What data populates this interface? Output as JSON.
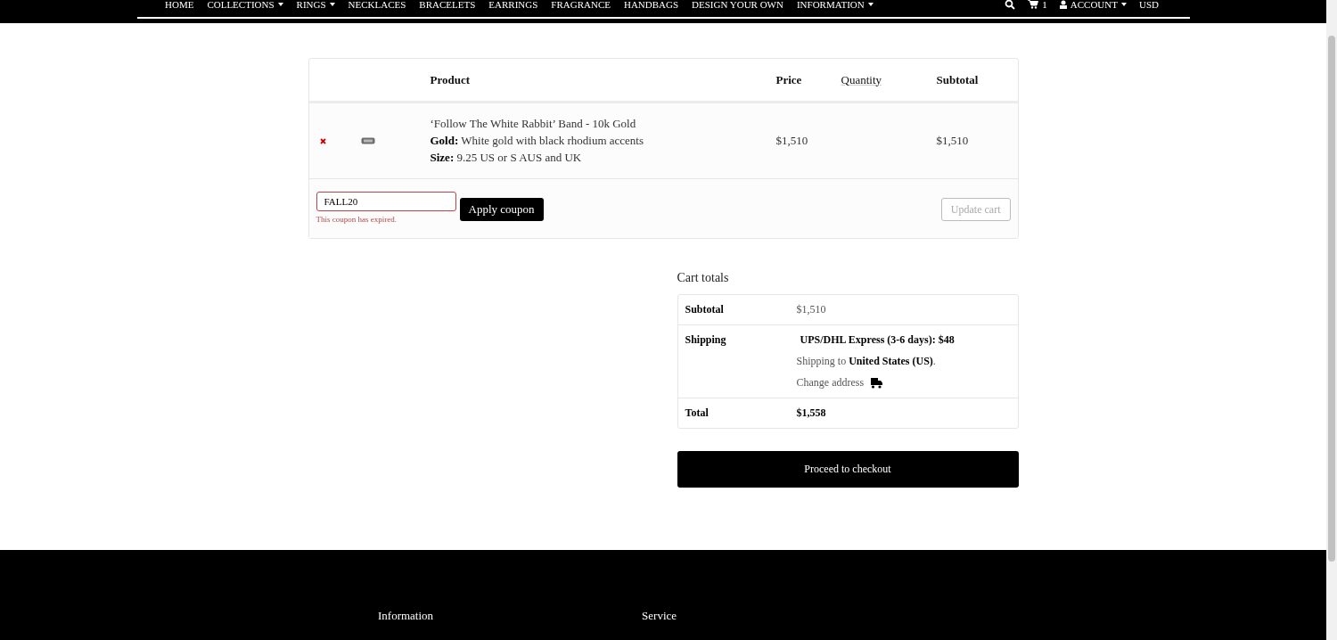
{
  "nav": {
    "items": [
      {
        "label": "HOME",
        "dropdown": false
      },
      {
        "label": "COLLECTIONS",
        "dropdown": true
      },
      {
        "label": "RINGS",
        "dropdown": true
      },
      {
        "label": "NECKLACES",
        "dropdown": false
      },
      {
        "label": "BRACELETS",
        "dropdown": false
      },
      {
        "label": "EARRINGS",
        "dropdown": false
      },
      {
        "label": "FRAGRANCE",
        "dropdown": false
      },
      {
        "label": "HANDBAGS",
        "dropdown": false
      },
      {
        "label": "DESIGN YOUR OWN",
        "dropdown": false
      },
      {
        "label": "INFORMATION",
        "dropdown": true
      }
    ],
    "cart_count": "1",
    "account": "ACCOUNT",
    "currency": "USD"
  },
  "cart": {
    "columns": [
      "Product",
      "Price",
      "Quantity",
      "Subtotal"
    ],
    "rows": [
      {
        "name": "‘Follow The White Rabbit’ Band - 10k Gold",
        "attributes": [
          {
            "label": "Gold:",
            "value": "White gold with black rhodium accents"
          },
          {
            "label": "Size:",
            "value": "9.25 US or S AUS and UK"
          }
        ],
        "price": "$1,510",
        "subtotal": "$1,510"
      }
    ],
    "coupon": {
      "value": "FALL20",
      "error": "This coupon has expired.",
      "button": "Apply coupon"
    },
    "update_button": {
      "label": "Update cart",
      "disabled": true
    }
  },
  "totals": {
    "title": "Cart totals",
    "subtotal_label": "Subtotal",
    "subtotal": "$1,510",
    "shipping_label": "Shipping",
    "shipping_method": "UPS/DHL Express (3-6 days): $48",
    "shipping_to": "Shipping to **United States (US)**.",
    "change_address": "Change address",
    "total_label": "Total",
    "total": "$1,558",
    "checkout": "Proceed to checkout"
  },
  "footer": {
    "headings": [
      "Information",
      "Service"
    ]
  }
}
